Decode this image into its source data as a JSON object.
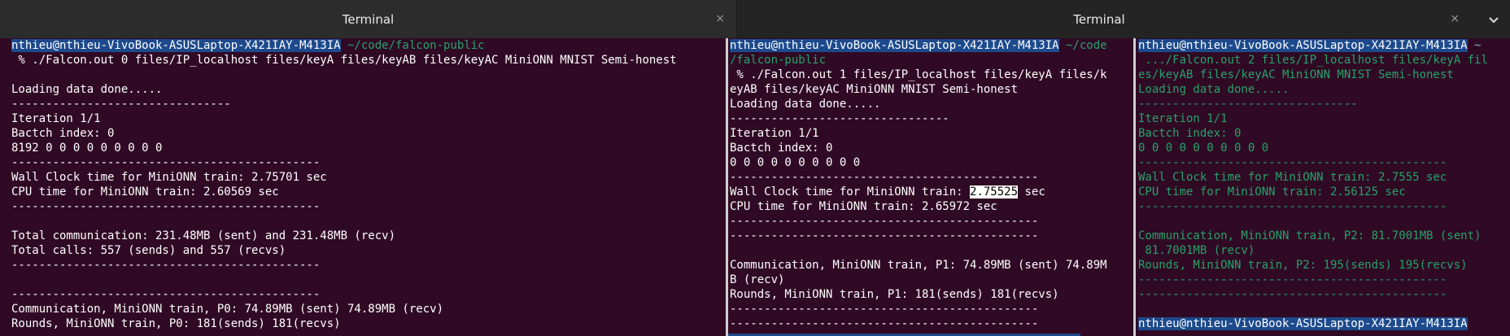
{
  "tabs": [
    {
      "label": "Terminal",
      "close": "×"
    },
    {
      "label": "Terminal",
      "close": "×"
    }
  ],
  "pane0": {
    "user_host": "nthieu@nthieu-VivoBook-ASUSLaptop-X421IAY-M413IA",
    "path": " ~/code/falcon-public",
    "command": " % ./Falcon.out 0 files/IP_localhost files/keyA files/keyAB files/keyAC MiniONN MNIST Semi-honest",
    "lines": [
      "",
      "Loading data done.....",
      "--------------------------------",
      "Iteration 1/1",
      "Bactch index: 0",
      "8192 0 0 0 0 0 0 0 0 0",
      "---------------------------------------------",
      "Wall Clock time for MiniONN train: 2.75701 sec",
      "CPU time for MiniONN train: 2.60569 sec",
      "---------------------------------------------",
      "",
      "Total communication: 231.48MB (sent) and 231.48MB (recv)",
      "Total calls: 557 (sends) and 557 (recvs)",
      "---------------------------------------------",
      "",
      "---------------------------------------------",
      "Communication, MiniONN train, P0: 74.89MB (sent) 74.89MB (recv)",
      "Rounds, MiniONN train, P0: 181(sends) 181(recvs)",
      "---------------------------------------------"
    ]
  },
  "pane1": {
    "user_host": "nthieu@nthieu-VivoBook-ASUSLaptop-X421IAY-M413IA",
    "path_part1": " ~/code",
    "path_part2": "/falcon-public",
    "command_line1": " % ./Falcon.out 1 files/IP_localhost files/keyA files/k",
    "command_line2": "eyAB files/keyAC MiniONN MNIST Semi-honest",
    "lines_top": [
      "Loading data done.....",
      "--------------------------------",
      "Iteration 1/1",
      "Bactch index: 0",
      "0 0 0 0 0 0 0 0 0 0",
      "---------------------------------------------"
    ],
    "wall_prefix": "Wall Clock time for MiniONN train: ",
    "wall_value": "2.75525",
    "wall_suffix": " sec",
    "lines_bottom": [
      "CPU time for MiniONN train: 2.65972 sec",
      "---------------------------------------------",
      "---------------------------------------------",
      "",
      "Communication, MiniONN train, P1: 74.89MB (sent) 74.89M",
      "B (recv)",
      "Rounds, MiniONN train, P1: 181(sends) 181(recvs)",
      "---------------------------------------------",
      "---------------------------------------------"
    ]
  },
  "pane2": {
    "user_host": "nthieu@nthieu-VivoBook-ASUSLaptop-X421IAY-M413IA",
    "path": " ~",
    "command_line1": " .../Falcon.out 2 files/IP_localhost files/keyA fil",
    "command_line2": "es/keyAB files/keyAC MiniONN MNIST Semi-honest",
    "lines": [
      "Loading data done.....",
      "--------------------------------",
      "Iteration 1/1",
      "Bactch index: 0",
      "0 0 0 0 0 0 0 0 0 0",
      "---------------------------------------------",
      "Wall Clock time for MiniONN train: 2.7555 sec",
      "CPU time for MiniONN train: 2.56125 sec",
      "---------------------------------------------",
      "",
      "Communication, MiniONN train, P2: 81.7001MB (sent)",
      " 81.7001MB (recv)",
      "Rounds, MiniONN train, P2: 195(sends) 195(recvs)",
      "---------------------------------------------",
      "---------------------------------------------",
      "",
      ""
    ],
    "prompt_bottom": "nthieu@nthieu-VivoBook-ASUSLaptop-X421IAY-M413IA"
  },
  "colors": {
    "background": "#300a24",
    "prompt_highlight": "#1d4a8c",
    "green_text": "#26a269",
    "tabbar": "#242424"
  }
}
